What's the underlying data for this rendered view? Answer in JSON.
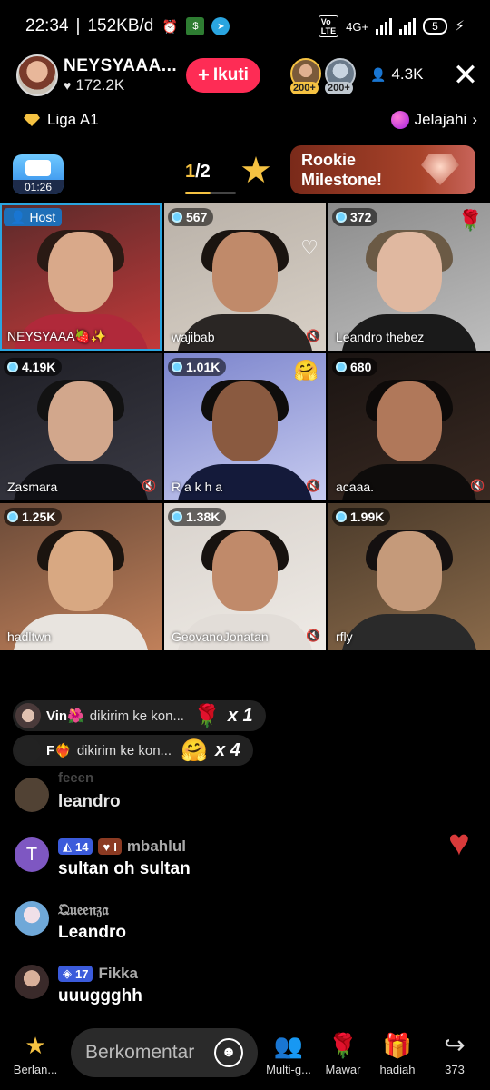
{
  "status_bar": {
    "time": "22:34",
    "data_rate": "152KB/d",
    "network": "4G+",
    "battery": "5"
  },
  "host": {
    "name": "NEYSYAAA...",
    "likes": "172.2K",
    "follow_label": "Ikuti"
  },
  "viewers": {
    "badge1": "200+",
    "badge2": "200+",
    "count": "4.3K"
  },
  "league": {
    "label": "Liga A1",
    "explore": "Jelajahi"
  },
  "tabs": {
    "timer": "01:26",
    "page_current": "1",
    "page_total": "/2",
    "milestone": "Rookie Milestone!"
  },
  "tiles": [
    {
      "name": "NEYSYAAA🍓✨",
      "host": "Host",
      "colors": [
        "#5a2a2a",
        "#c23a3a",
        "#d9a98a",
        "#2a1a14",
        "#b0293a"
      ]
    },
    {
      "name": "wajibab",
      "score": "567",
      "colors": [
        "#b9b1a8",
        "#d8d0c6",
        "#c08a6a",
        "#1a1410",
        "#2a2624"
      ]
    },
    {
      "name": "Leandro thebez",
      "score": "372",
      "colors": [
        "#8c8c8c",
        "#bdbdbd",
        "#e0b8a0",
        "#6b5a45",
        "#1a1a1a"
      ]
    },
    {
      "name": "Zasmara",
      "score": "4.19K",
      "colors": [
        "#1f1f26",
        "#3a3a44",
        "#d2a78c",
        "#121212",
        "#101014"
      ]
    },
    {
      "name": "R a k h a",
      "score": "1.01K",
      "colors": [
        "#7b84cc",
        "#c7cbf0",
        "#8a5a40",
        "#0f0d0c",
        "#141a3a"
      ]
    },
    {
      "name": "acaaa.",
      "score": "680",
      "colors": [
        "#1a1412",
        "#3a2a22",
        "#b0785a",
        "#0d0a09",
        "#0e0c0b"
      ]
    },
    {
      "name": "hadltwn",
      "score": "1.25K",
      "colors": [
        "#6a4a38",
        "#c0805a",
        "#d8a882",
        "#1b140f",
        "#e8e4df"
      ]
    },
    {
      "name": "GeovanoJonatan",
      "score": "1.38K",
      "colors": [
        "#d8d2cc",
        "#efebe6",
        "#c08a6a",
        "#17120f",
        "#e2ddd8"
      ]
    },
    {
      "name": "rfly",
      "score": "1.99K",
      "colors": [
        "#4a3a2a",
        "#8a6a4a",
        "#c59a7a",
        "#141010",
        "#2a2a2a"
      ]
    }
  ],
  "gifts": [
    {
      "user": "Vin🌺",
      "text": "dikirim ke kon...",
      "icon": "🌹",
      "count": "x 1"
    },
    {
      "user": "F❤️‍🔥",
      "text": "dikirim ke kon...",
      "icon": "🤗",
      "count": "x 4"
    }
  ],
  "comments": [
    {
      "user": "feeen",
      "message": "leandro",
      "avatar_color": "#5a4a3a"
    },
    {
      "user": "mbahlul",
      "message": "sultan oh sultan",
      "avatar_letter": "T",
      "avatar_color": "#7e57c2",
      "level": "14",
      "fan_level": "I"
    },
    {
      "user": "𝔔𝔲𝔢𝔢𝔫𝔷𝔞",
      "message": "Leandro",
      "avatar_color": "#6fa8d8"
    },
    {
      "user": "Fikka",
      "message": "uuuggghh",
      "avatar_color": "#6a5a50",
      "level": "17"
    }
  ],
  "bottom": {
    "explore_label": "Berlan...",
    "comment_placeholder": "Berkomentar",
    "multi_label": "Multi-g...",
    "rose_label": "Mawar",
    "gift_label": "hadiah",
    "share_count": "373"
  }
}
